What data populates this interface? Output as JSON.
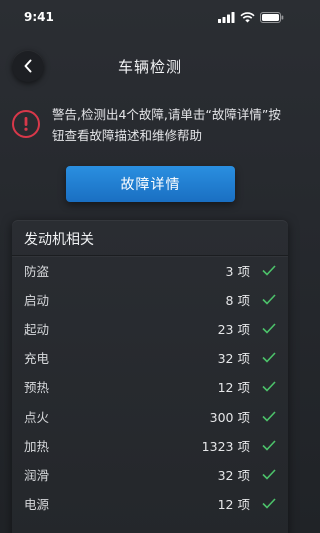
{
  "status_bar": {
    "time": "9:41"
  },
  "nav": {
    "title": "车辆检测"
  },
  "warning": {
    "text": "警告,检测出4个故障,请单击“故障详情”按钮查看故障描述和维修帮助"
  },
  "detail_button": {
    "label": "故障详情"
  },
  "colors": {
    "accent": "#2282d6",
    "warning": "#d8384a",
    "check": "#4cc26a"
  },
  "engine_section": {
    "title": "发动机相关",
    "unit": "项",
    "items": [
      {
        "name": "防盗",
        "count": "3"
      },
      {
        "name": "启动",
        "count": "8"
      },
      {
        "name": "起动",
        "count": "23"
      },
      {
        "name": "充电",
        "count": "32"
      },
      {
        "name": "预热",
        "count": "12"
      },
      {
        "name": "点火",
        "count": "300"
      },
      {
        "name": "加热",
        "count": "1323"
      },
      {
        "name": "润滑",
        "count": "32"
      },
      {
        "name": "电源",
        "count": "12"
      }
    ]
  }
}
